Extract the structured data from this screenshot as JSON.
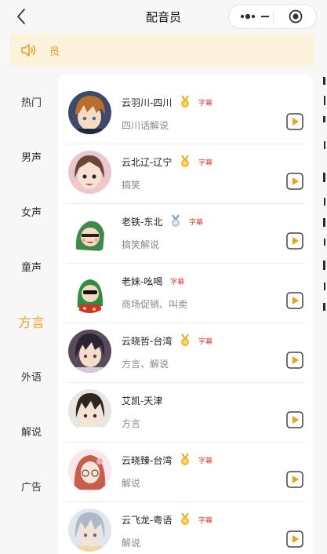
{
  "header": {
    "title": "配音员"
  },
  "notice": {
    "text": "员"
  },
  "sidebar": {
    "items": [
      {
        "label": "热门"
      },
      {
        "label": "男声"
      },
      {
        "label": "女声"
      },
      {
        "label": "童声"
      },
      {
        "label": "方言"
      },
      {
        "label": "外语"
      },
      {
        "label": "解说"
      },
      {
        "label": "广告"
      }
    ],
    "active": "方言"
  },
  "voices": [
    {
      "name": "云羽川-四川",
      "medal": "gold",
      "tag": "字幕",
      "desc": "四川话解说"
    },
    {
      "name": "云北辽-辽宁",
      "medal": "gold",
      "tag": "字幕",
      "desc": "搞笑"
    },
    {
      "name": "老铁-东北",
      "medal": "silver",
      "tag": "字幕",
      "desc": "搞笑解说"
    },
    {
      "name": "老妹-吆喝",
      "medal": "",
      "tag": "字幕",
      "desc": "商场促销、叫卖"
    },
    {
      "name": "云晓哲-台湾",
      "medal": "gold",
      "tag": "字幕",
      "desc": "方言、解说"
    },
    {
      "name": "艾凯-天津",
      "medal": "",
      "tag": "",
      "desc": "方言"
    },
    {
      "name": "云晓臻-台湾",
      "medal": "gold",
      "tag": "字幕",
      "desc": "解说"
    },
    {
      "name": "云飞龙-粤语",
      "medal": "gold",
      "tag": "字幕",
      "desc": "解说"
    }
  ],
  "colors": {
    "accent": "#f2a52f",
    "notice_bg": "#fdf3dd",
    "tag": "#e23c3c",
    "play": "#e8a21c"
  },
  "icons": {
    "back": "chevron-left-icon",
    "more": "more-dots-icon",
    "close": "close-circle-icon",
    "speaker": "speaker-icon",
    "play": "play-icon"
  }
}
